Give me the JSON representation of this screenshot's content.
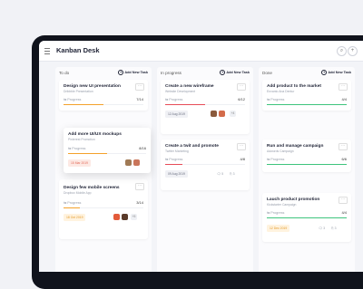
{
  "app": {
    "title": "Kanban Desk"
  },
  "header": {
    "search_icon": "search-icon",
    "add_icon": "plus-icon"
  },
  "progress_label": "Progress",
  "columns": [
    {
      "name": "To do",
      "add_label": "Add New Task",
      "cards": [
        {
          "title": "Design new UI presentation",
          "subtitle": "Dribbble Presentation",
          "progress": "7/14",
          "fraction": 0.5,
          "color": "#f4a12a"
        },
        {
          "title": "Add more UI/UX mockups",
          "subtitle": "Pinterest Promotion",
          "progress": "8/16",
          "fraction": 0.5,
          "color": "#f4a12a",
          "date": "15 Mar 2019",
          "date_color": "#fde9e4",
          "date_text_color": "#e36b5a"
        },
        {
          "title": "Design few mobile screens",
          "subtitle": "Dropbox Mobile App",
          "progress": "3/14",
          "fraction": 0.2,
          "color": "#f4a12a",
          "date": "18 Oct 2019",
          "date_color": "#fff3df",
          "date_text_color": "#e59a2a",
          "extra": "+5"
        }
      ]
    },
    {
      "name": "In progress",
      "add_label": "Add New Task",
      "cards": [
        {
          "title": "Create a new wireframe",
          "subtitle": "Website Development",
          "progress": "6/12",
          "fraction": 0.5,
          "color": "#e74c58",
          "date": "12 Aug 2019",
          "date_color": "#f0f1f5",
          "date_text_color": "#6b7080",
          "extra": "+4"
        },
        {
          "title": "Create a twit and promote",
          "subtitle": "Twitter Marketing",
          "progress": "4/8",
          "fraction": 0.22,
          "color": "#e74c58",
          "date": "09 Aug 2019",
          "date_color": "#f0f1f5",
          "date_text_color": "#6b7080",
          "comments": "5",
          "files": "3"
        }
      ]
    },
    {
      "name": "Done",
      "add_label": "Add New Task",
      "cards": [
        {
          "title": "Add product to the market",
          "subtitle": "Envanto Ana Dentur",
          "progress": "4/4",
          "fraction": 1,
          "color": "#3ec47d"
        },
        {
          "title": "Run and manage campaign",
          "subtitle": "Adwords Campaign",
          "progress": "6/6",
          "fraction": 1,
          "color": "#3ec47d"
        },
        {
          "title": "Lauch product promotion",
          "subtitle": "Kickstarter Campaign",
          "progress": "4/4",
          "fraction": 1,
          "color": "#3ec47d",
          "date": "12 Dec 2019",
          "date_color": "#fff3df",
          "date_text_color": "#e59a2a",
          "comments": "3",
          "files": "3"
        }
      ]
    }
  ]
}
